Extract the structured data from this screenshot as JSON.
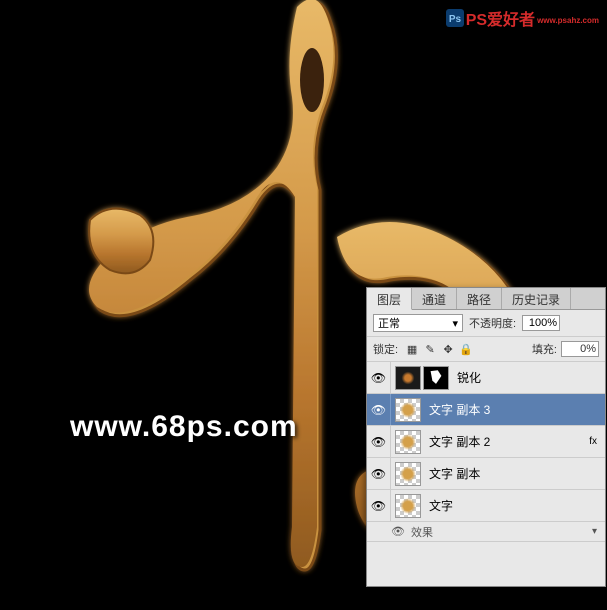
{
  "watermarks": {
    "url": "www.68ps.com",
    "brand": "PS爱好者",
    "brand_sub": "www.psahz.com"
  },
  "panel": {
    "tabs": [
      "图层",
      "通道",
      "路径",
      "历史记录"
    ],
    "blend_mode": "正常",
    "opacity_label": "不透明度:",
    "opacity_value": "100%",
    "lock_label": "锁定:",
    "fill_label": "填充:",
    "fill_value": "0%",
    "layers": [
      {
        "name": "锐化",
        "type": "adjust",
        "selected": false
      },
      {
        "name": "文字 副本 3",
        "type": "text",
        "selected": true
      },
      {
        "name": "文字 副本 2",
        "type": "text",
        "selected": false
      },
      {
        "name": "文字 副本",
        "type": "text",
        "selected": false
      },
      {
        "name": "文字",
        "type": "text",
        "selected": false
      }
    ],
    "fx_label": "效果",
    "fx_badge": "fx"
  }
}
